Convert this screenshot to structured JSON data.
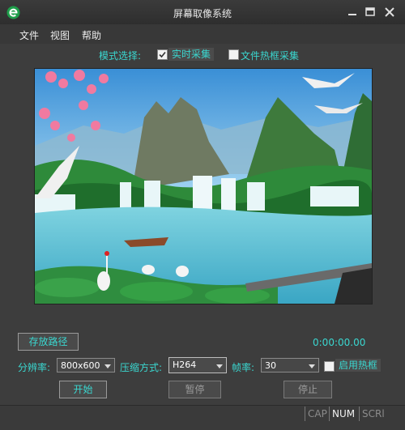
{
  "window": {
    "title": "屏幕取像系统"
  },
  "menu": [
    {
      "label": "文件"
    },
    {
      "label": "视图"
    },
    {
      "label": "帮助"
    }
  ],
  "mode": {
    "label": "模式选择:",
    "options": [
      {
        "label": "实时采集",
        "checked": true
      },
      {
        "label": "文件热框采集",
        "checked": false
      }
    ]
  },
  "controls": {
    "save_path_label": "存放路径",
    "timer": "0:00:00.00",
    "resolution_label": "分辨率:",
    "resolution_value": "800x600",
    "compression_label": "压缩方式:",
    "compression_value": "H264",
    "framerate_label": "帧率:",
    "framerate_value": "30",
    "hotkey_label": "启用热框",
    "hotkey_checked": false,
    "start_label": "开始",
    "pause_label": "暂停",
    "stop_label": "停止"
  },
  "statusbar": {
    "cap": "CAP",
    "num": "NUM",
    "scrl": "SCRl"
  },
  "colors": {
    "accent": "#3ad7d0",
    "window_bg": "#3d3d3d"
  }
}
